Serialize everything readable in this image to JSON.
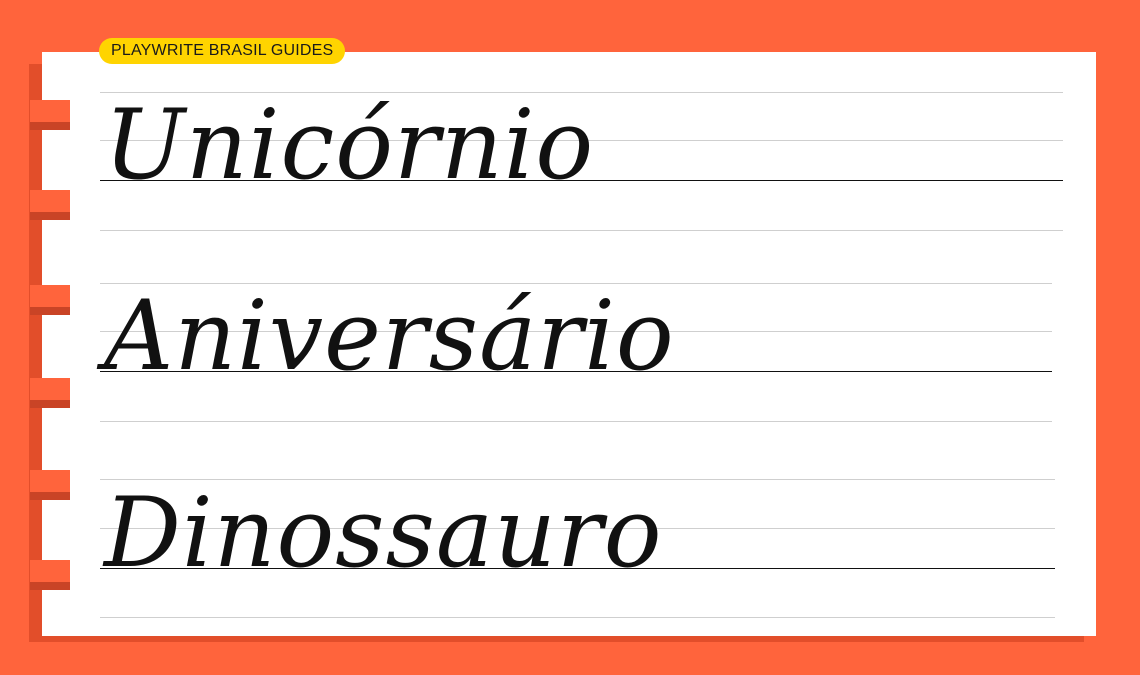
{
  "badge": {
    "label": "PLAYWRITE BRASIL GUIDES"
  },
  "words": [
    "Unicórnio",
    "Aniversário",
    "Dinossauro"
  ],
  "colors": {
    "background": "#FF643C",
    "badge": "#FFD400",
    "paper": "#FFFFFF",
    "ink": "#111111",
    "guide_line": "#CFCFCF"
  }
}
